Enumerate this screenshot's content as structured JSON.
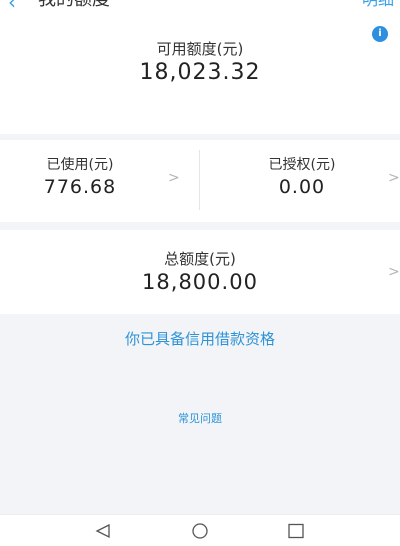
{
  "header": {
    "title": "我的额度",
    "right_link": "明细"
  },
  "available": {
    "label": "可用额度(元)",
    "value": "18,023.32",
    "badge": "i"
  },
  "used": {
    "label": "已使用(元)",
    "value": "776.68"
  },
  "authorized": {
    "label": "已授权(元)",
    "value": "0.00"
  },
  "total": {
    "label": "总额度(元)",
    "value": "18,800.00"
  },
  "links": {
    "qualification": "你已具备信用借款资格",
    "faq": "常见问题"
  },
  "chevron": ">",
  "colors": {
    "accent": "#2d93d6",
    "background": "#f3f4f8",
    "card": "#ffffff"
  },
  "icons": {
    "back": "back-arrow-icon",
    "info": "info-icon",
    "nav_back": "triangle-back-icon",
    "nav_home": "circle-home-icon",
    "nav_recent": "square-recent-icon"
  }
}
